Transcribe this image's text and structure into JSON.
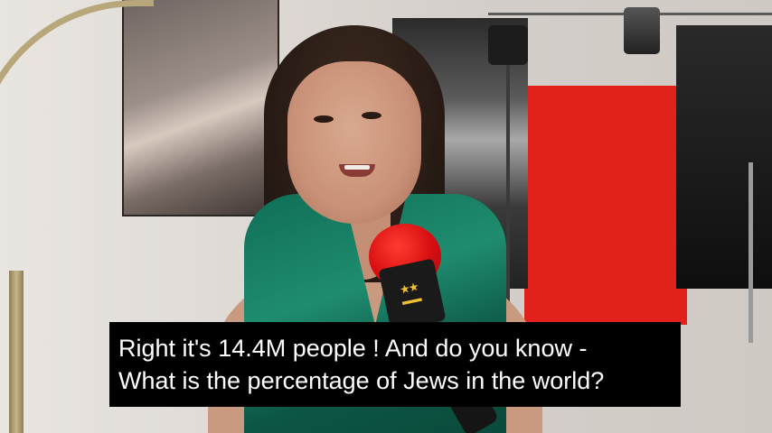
{
  "subtitle": {
    "line1": "Right it's 14.4M people ! And do you know -",
    "line2": "What is the percentage of Jews in the world?"
  },
  "microphone": {
    "logo_color": "#f2c230",
    "head_color": "#e0141a"
  },
  "scene": {
    "backdrop_color": "#e0221b",
    "dress_color": "#1f8c6f"
  }
}
